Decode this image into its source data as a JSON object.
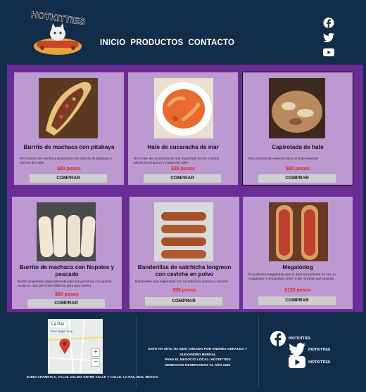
{
  "header": {
    "logo_text": "HOTKITTIES",
    "nav": [
      {
        "label": "INICIO"
      },
      {
        "label": "PRODUCTOS"
      },
      {
        "label": "CONTACTO"
      }
    ],
    "social_icons": [
      "facebook-icon",
      "twitter-icon",
      "youtube-icon"
    ]
  },
  "products": [
    {
      "title": "Burrito de machaca con pitahaya",
      "description": "Rico burrito de machaca preparado con mezcla de pitahaya y mezcla del valle",
      "price": "$80 pesos",
      "buy_label": "COMPRAR"
    },
    {
      "title": "Hate de cucaracha de mar",
      "description": "Rico hate de cucaracha de mar importado de los Cabitos, salchicha longmon y restos del odile",
      "price": "$35 pesos",
      "buy_label": "COMPRAR"
    },
    {
      "title": "Capirotada de hate",
      "description": "Rica mezcla de especial para un hate especial",
      "price": "$20 pesos",
      "buy_label": "COMPRAR"
    },
    {
      "title": "Burrito de machaca con Nopales y pescado",
      "description": "Burrito preparado especialmente para las personas con gustos exoticos, raro pero bien sabroso para que vuelva",
      "price": "$90 pesos",
      "buy_label": "COMPRAR"
    },
    {
      "title": "Banderillas de salchicha longmon con ceviche en polvo",
      "description": "Banderillas muy regionales con un saborsito pernos a ceviche",
      "price": "$50 pesos",
      "buy_label": "COMPRAR"
    },
    {
      "title": "Megalodog",
      "description": "El poderoso megalodog que te dará los poderes de ser un megalodon y te puedas comer a las morritas que quieras",
      "price": "$120 pesos",
      "buy_label": "COMPRAR"
    }
  ],
  "footer": {
    "map": {
      "place": "La Paz",
      "link": "View larger map",
      "zoom_in": "+",
      "zoom_out": "−"
    },
    "address": "EJIDO CHAMETLA, CALLE COLIMA ENTRE CALLE Y CALLE. LA PAZ, BCS, MÉXICO",
    "credits": [
      "ESTE HA SITIO HA SIDO CREADO POR ANDRÉS GERALDO Y ALEXANDRO BERNAL",
      "PARA EL NEGOCIO LOCAL: HOTKITTIES",
      "DERECHOS RESERVADOS AL AÑO 2020"
    ],
    "social": [
      {
        "icon": "facebook-icon",
        "handle": "/HOTKITTIES"
      },
      {
        "icon": "twitter-icon",
        "handle": "/HOTKITTIES"
      },
      {
        "icon": "youtube-icon",
        "handle": "/HOTKITTIES"
      }
    ]
  },
  "colors": {
    "header_bg": "#122d4a",
    "main_bg": "#6a2d96",
    "card_bg": "#bc9ad1",
    "price": "#e32424",
    "button": "#cfcfcf"
  }
}
